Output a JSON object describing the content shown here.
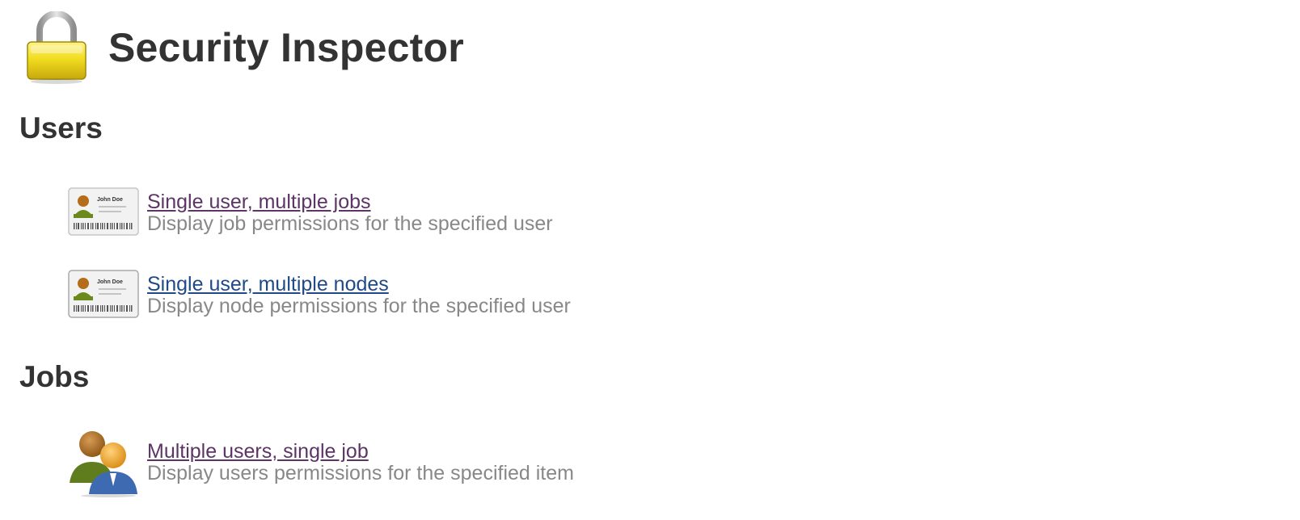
{
  "page": {
    "title": "Security Inspector"
  },
  "sections": [
    {
      "heading": "Users",
      "entries": [
        {
          "icon": "user-id-card-icon",
          "link": "Single user, multiple jobs",
          "description": "Display job permissions for the specified user",
          "card_name": "John Doe"
        },
        {
          "icon": "user-id-card-icon",
          "link": "Single user, multiple nodes",
          "description": "Display node permissions for the specified user",
          "card_name": "John Doe"
        }
      ]
    },
    {
      "heading": "Jobs",
      "entries": [
        {
          "icon": "users-group-icon",
          "link": "Multiple users, single job",
          "description": "Display users permissions for the specified item"
        }
      ]
    }
  ],
  "colors": {
    "title": "#333333",
    "link_visited": "#5c3566",
    "link_unvisited": "#204a87",
    "description": "#888888",
    "lock": "#e8d21a"
  }
}
